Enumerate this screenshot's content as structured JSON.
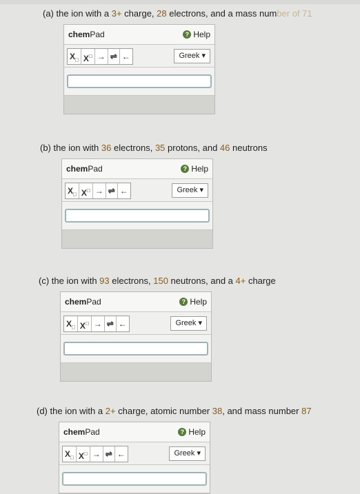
{
  "questions": [
    {
      "label": "(a)",
      "parts": [
        "the ion with a ",
        "3+",
        " charge, ",
        "28",
        " electrons, and a mass num",
        "ber of 71"
      ]
    },
    {
      "label": "(b)",
      "parts": [
        "the ion with ",
        "36",
        " electrons, ",
        "35",
        " protons, and ",
        "46",
        " neutrons"
      ]
    },
    {
      "label": "(c)",
      "parts": [
        "the ion with ",
        "93",
        " electrons, ",
        "150",
        " neutrons, and a ",
        "4+",
        " charge"
      ]
    },
    {
      "label": "(d)",
      "parts": [
        "the ion with a ",
        "2+",
        " charge, atomic number ",
        "38",
        ", and mass number ",
        "87"
      ]
    }
  ],
  "chempad": {
    "title_bold": "chem",
    "title_rest": "Pad",
    "help_label": "Help",
    "greek_label": "Greek ▾",
    "toolbar": {
      "subscript": "X",
      "subscript_box": "□",
      "superscript": "X",
      "superscript_box": "□",
      "arrow": "→",
      "equilibrium": "⇌",
      "left_arrow": "←"
    }
  }
}
